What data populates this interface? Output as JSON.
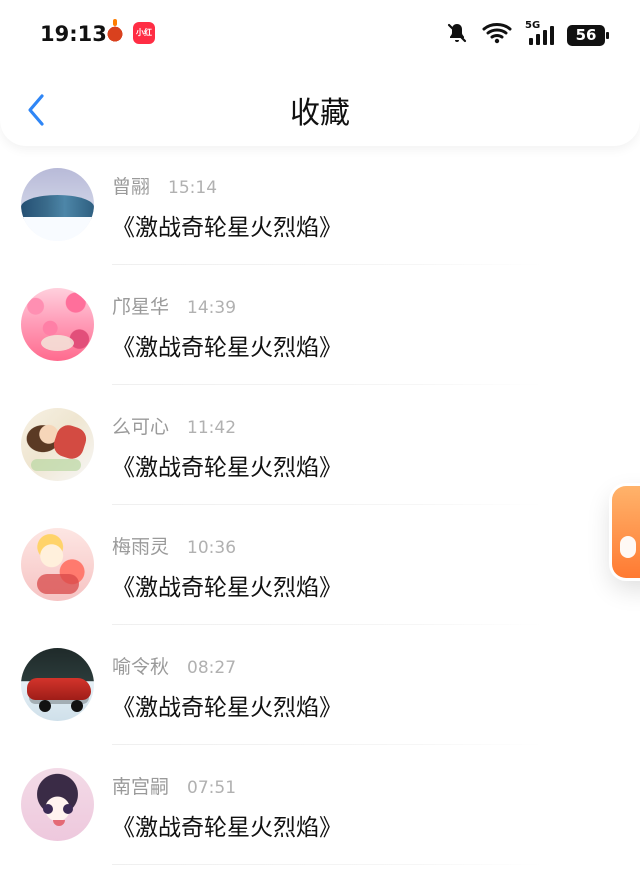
{
  "status_bar": {
    "time": "19:13",
    "app_badge_1": "hotpot-icon",
    "app_badge_2_text": "小红书",
    "network": "5G",
    "battery": "56"
  },
  "nav": {
    "title": "收藏"
  },
  "items": [
    {
      "name": "曾翮",
      "time": "15:14",
      "message": "《激战奇轮星火烈焰》",
      "avatar": "snowy-landscape"
    },
    {
      "name": "邝星华",
      "time": "14:39",
      "message": "《激战奇轮星火烈焰》",
      "avatar": "pink-blossoms"
    },
    {
      "name": "么可心",
      "time": "11:42",
      "message": "《激战奇轮星火烈焰》",
      "avatar": "girl-photo"
    },
    {
      "name": "梅雨灵",
      "time": "10:36",
      "message": "《激战奇轮星火烈焰》",
      "avatar": "anime-art"
    },
    {
      "name": "喻令秋",
      "time": "08:27",
      "message": "《激战奇轮星火烈焰》",
      "avatar": "red-car"
    },
    {
      "name": "南宫嗣",
      "time": "07:51",
      "message": "《激战奇轮星火烈焰》",
      "avatar": "anime-girl"
    }
  ],
  "colors": {
    "back_accent": "#2f86f6",
    "meta_text": "#9a9a9a",
    "time_text": "#b1b1b1"
  }
}
